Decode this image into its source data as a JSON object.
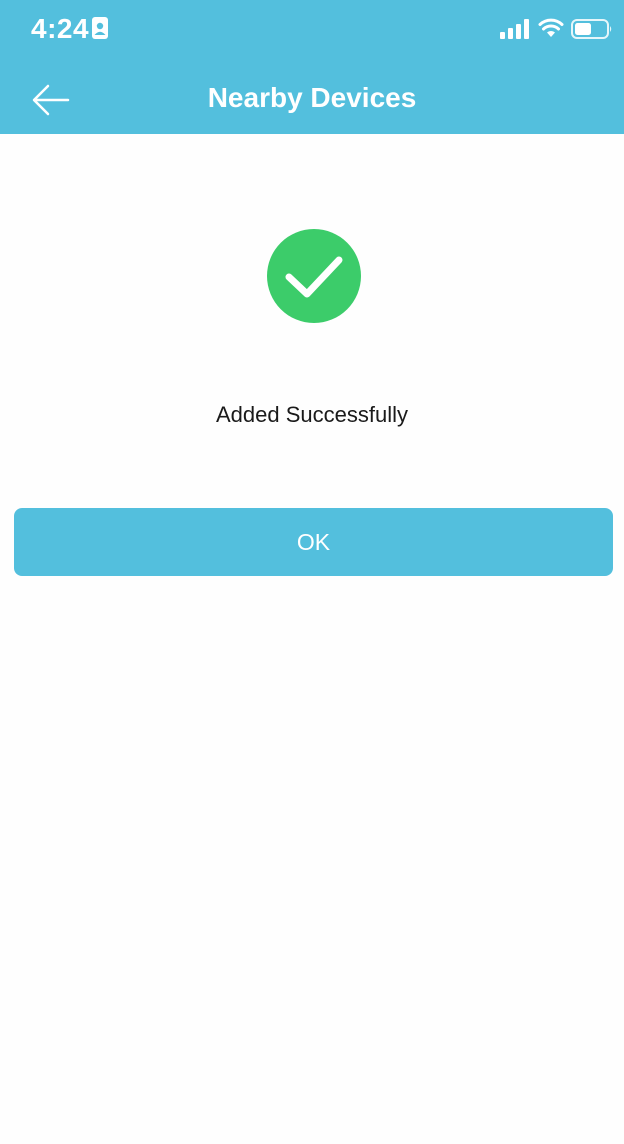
{
  "status_bar": {
    "time": "4:24",
    "icons": [
      "id-badge-icon",
      "signal-icon",
      "wifi-icon",
      "battery-icon"
    ]
  },
  "header": {
    "title": "Nearby Devices",
    "back_icon": "back-arrow-icon"
  },
  "main": {
    "status_icon": "checkmark-circle-icon",
    "message": "Added Successfully",
    "ok_label": "OK"
  },
  "colors": {
    "accent": "#53bfdd",
    "success": "#3ccc6a",
    "background": "#fefefe",
    "text": "#1a1a1a"
  }
}
